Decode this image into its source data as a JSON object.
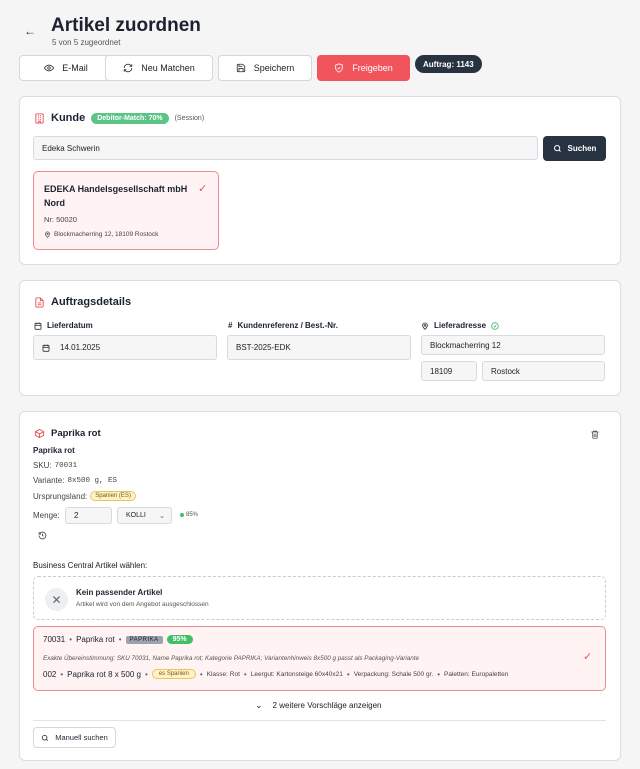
{
  "header": {
    "title": "Artikel zuordnen",
    "subtitle": "5 von 5 zugeordnet"
  },
  "toolbar": {
    "email": "E-Mail",
    "new_match": "Neu Matchen",
    "save": "Speichern",
    "release": "Freigeben",
    "order_badge": "Auftrag: 1143"
  },
  "customer": {
    "title": "Kunde",
    "match_badge": "Debitor-Match: 70%",
    "session": "(Session)",
    "search_value": "Edeka Schwerin",
    "search_button": "Suchen",
    "selected": {
      "name_line1": "EDEKA Handelsgesellschaft mbH",
      "name_line2": "Nord",
      "number": "Nr: 50020",
      "address": "Blockmacherring 12, 18109 Rostock"
    }
  },
  "order": {
    "title": "Auftragsdetails",
    "delivery_date_label": "Lieferdatum",
    "delivery_date": "14.01.2025",
    "reference_label": "Kundenreferenz / Best.-Nr.",
    "reference": "BST-2025-EDK",
    "address_label": "Lieferadresse",
    "street": "Blockmacherring 12",
    "zip": "18109",
    "city": "Rostock"
  },
  "article": {
    "title": "Paprika rot",
    "name": "Paprika rot",
    "sku_label": "SKU:",
    "sku": "70031",
    "variant_label": "Variante:",
    "variant": "8x500 g, ES",
    "origin_label": "Ursprungsland:",
    "origin": "Spanien (ES)",
    "qty_label": "Menge:",
    "qty": "2",
    "unit": "KOLLI",
    "confidence": "85%",
    "bc_label": "Business Central Artikel wählen:",
    "none_title": "Kein passender Artikel",
    "none_sub": "Artikel wird von dem Angebot ausgeschlossen",
    "match": {
      "code": "70031",
      "name": "Paprika rot",
      "category": "PAPRIKA",
      "percent": "95%",
      "reason": "Exakte Übereinstimmung: SKU 70031, Name Paprika rot; Kategorie PAPRIKA; Variantenhinweis 8x500 g passt als Packaging-Variante",
      "variant_code": "002",
      "variant_name": "Paprika rot 8 x 500 g",
      "origin": "es Spanien",
      "klasse": "Klasse: Rot",
      "leergut": "Leergut: Kartonsteige 60x40x21",
      "verpackung": "Verpackung: Schale 500 gr.",
      "paletten": "Paletten: Europaletten"
    },
    "more": "2 weitere Vorschläge anzeigen",
    "manual": "Manuell suchen"
  }
}
